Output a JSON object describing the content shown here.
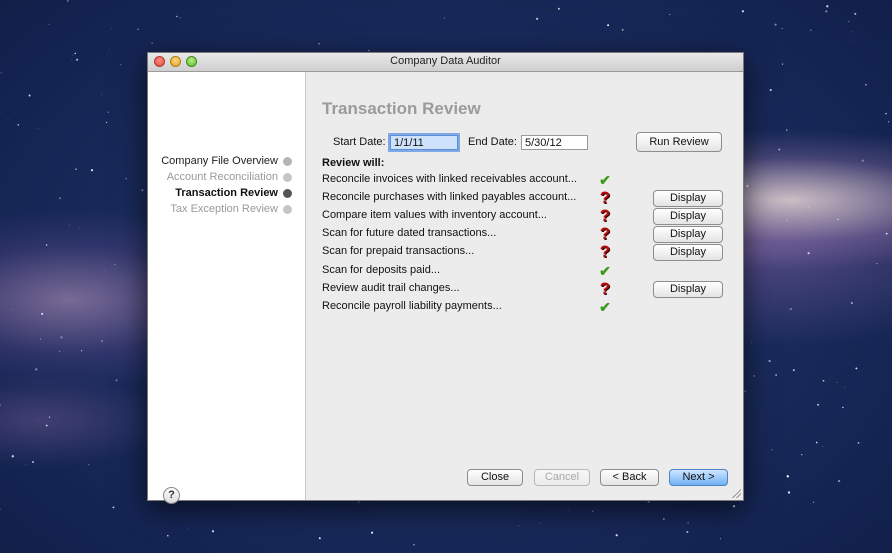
{
  "window": {
    "title": "Company Data Auditor"
  },
  "sidebar": {
    "steps": [
      {
        "label": "Company File Overview",
        "state": "done"
      },
      {
        "label": "Account Reconciliation",
        "state": "pending"
      },
      {
        "label": "Transaction Review",
        "state": "current"
      },
      {
        "label": "Tax Exception Review",
        "state": "pending"
      }
    ],
    "help_label": "?"
  },
  "main": {
    "title": "Transaction Review",
    "start_date_label": "Start Date:",
    "start_date_value": "1/1/11",
    "end_date_label": "End Date:",
    "end_date_value": "5/30/12",
    "run_review_label": "Run Review",
    "review_will_label": "Review will:",
    "items": [
      {
        "text": "Reconcile invoices with linked receivables account...",
        "status": "pass",
        "status_icon": "check-icon"
      },
      {
        "text": "Reconcile purchases with linked payables account...",
        "status": "issue",
        "status_icon": "question-icon",
        "action": "Display"
      },
      {
        "text": "Compare item values with inventory account...",
        "status": "issue",
        "status_icon": "question-icon",
        "action": "Display"
      },
      {
        "text": "Scan for future dated transactions...",
        "status": "issue",
        "status_icon": "question-icon",
        "action": "Display"
      },
      {
        "text": "Scan for prepaid transactions...",
        "status": "issue",
        "status_icon": "question-icon",
        "action": "Display"
      },
      {
        "text": "Scan for deposits paid...",
        "status": "pass",
        "status_icon": "check-icon"
      },
      {
        "text": "Review audit trail changes...",
        "status": "issue",
        "status_icon": "question-icon",
        "action": "Display"
      },
      {
        "text": "Reconcile payroll liability payments...",
        "status": "pass",
        "status_icon": "check-icon"
      }
    ]
  },
  "footer": {
    "close_label": "Close",
    "cancel_label": "Cancel",
    "back_label": "< Back",
    "next_label": "Next >"
  },
  "colors": {
    "check": "#3e9a1e",
    "question": "#b80e0e",
    "primary_button": "#6fb1f5",
    "field_focus": "#cfe2fb"
  }
}
